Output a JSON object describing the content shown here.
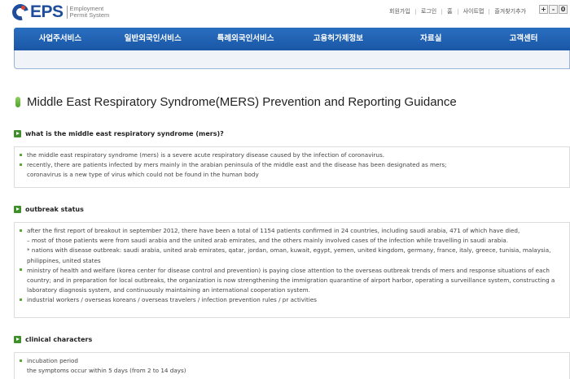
{
  "header": {
    "logo_text": "EPS",
    "logo_sub_line1": "Employment",
    "logo_sub_line2": "Permit System",
    "util_links": [
      "회원가입",
      "로그인",
      "홈",
      "사이트맵",
      "즐겨찾기추가"
    ],
    "zoom": [
      "+",
      "-",
      "0"
    ]
  },
  "nav": {
    "tabs": [
      "사업주서비스",
      "일반외국인서비스",
      "특례외국인서비스",
      "고용허가제정보",
      "자료실",
      "고객센터"
    ]
  },
  "page": {
    "title": "Middle East Respiratory Syndrome(MERS) Prevention and Reporting Guidance"
  },
  "sections": [
    {
      "title": "what is the middle east respiratory syndrome (mers)?",
      "lines": [
        "the middle east respiratory syndrome (mers) is a severe acute respiratory disease caused by the infection of coronavirus.",
        "recently, there are patients infected by mers mainly in the arabian peninsula of the middle east and the disease has been designated as mers;",
        "coronavirus is a new type of virus which could not be found in the human body"
      ]
    },
    {
      "title": "outbreak status",
      "lines": [
        "after the first report of breakout in september 2012, there have been a total of 1154 patients confirmed in 24 countries, including saudi arabia, 471 of which have died,",
        "– most of those patients were from saudi arabia and the united arab emirates, and the others mainly involved cases of the infection while travelling in saudi arabia.",
        "* nations with disease outbreak: saudi arabia, united arab emirates, qatar, jordan, oman, kuwait, egypt, yemen, united kingdom, germany, france, italy, greece, tunisia, malaysia,",
        "philippines, united states",
        "ministry of health and welfare (korea center for disease control and prevention) is paying close attention to the overseas outbreak trends of mers and response situations of each",
        "country; and in preparation for local outbreaks, the organization is now strengthening the immigration quarantine of airport harbor, operating a surveillance system, constructing a",
        "laboratory diagnosis system, and continuously maintaining an international cooperation system.",
        "industrial workers / overseas koreans / overseas travelers / infection prevention rules / pr activities"
      ]
    },
    {
      "title": "clinical characters",
      "lines": [
        "incubation period",
        "the symptoms occur within 5 days (from 2 to 14 days)"
      ]
    }
  ]
}
